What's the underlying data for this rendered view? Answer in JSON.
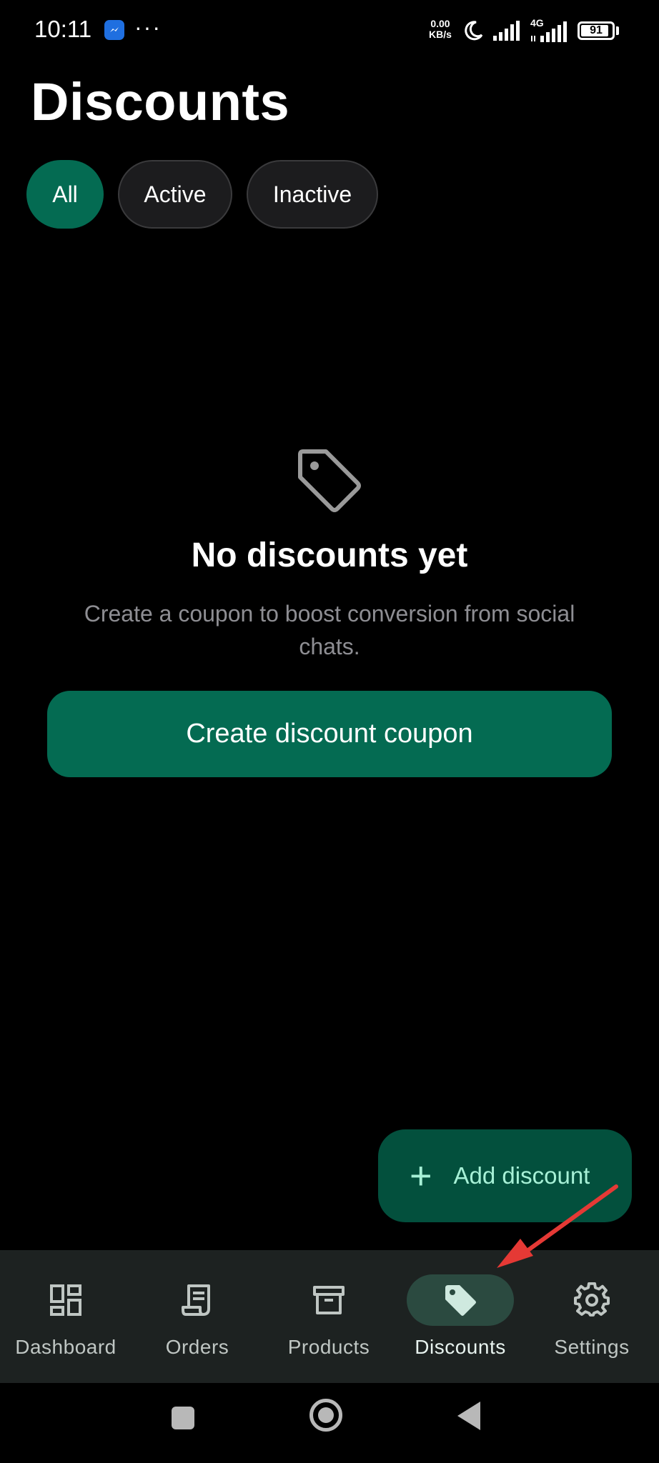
{
  "status_bar": {
    "time": "10:11",
    "net_speed_value": "0.00",
    "net_speed_unit": "KB/s",
    "network_type": "4G",
    "battery_level": "91",
    "battery_fraction": 0.91
  },
  "header": {
    "title": "Discounts"
  },
  "filters": [
    {
      "label": "All",
      "selected": true
    },
    {
      "label": "Active",
      "selected": false
    },
    {
      "label": "Inactive",
      "selected": false
    }
  ],
  "empty_state": {
    "title": "No discounts yet",
    "subtitle": "Create a coupon to boost conversion from social chats.",
    "button_label": "Create discount coupon"
  },
  "fab": {
    "label": "Add discount"
  },
  "bottom_nav": [
    {
      "label": "Dashboard",
      "icon": "dashboard-icon",
      "selected": false
    },
    {
      "label": "Orders",
      "icon": "receipt-icon",
      "selected": false
    },
    {
      "label": "Products",
      "icon": "archive-box-icon",
      "selected": false
    },
    {
      "label": "Discounts",
      "icon": "tag-icon",
      "selected": true
    },
    {
      "label": "Settings",
      "icon": "gear-icon",
      "selected": false
    }
  ],
  "colors": {
    "background": "#000000",
    "accent": "#046b52",
    "fab_background": "#03503d",
    "fab_text": "#a6f0d6",
    "nav_background": "#1d2221",
    "nav_selected_pill": "#2b4a40",
    "annotation_arrow": "#e53935"
  }
}
